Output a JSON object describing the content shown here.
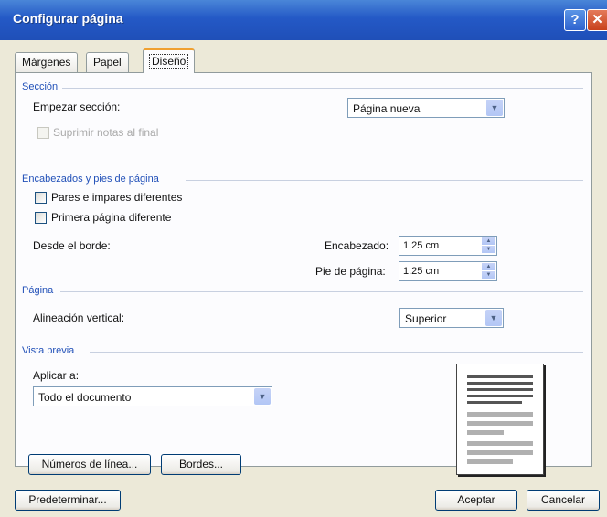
{
  "window": {
    "title": "Configurar página",
    "help_label": "?",
    "close_label": "✕"
  },
  "tabs": [
    {
      "label": "Márgenes",
      "active": false
    },
    {
      "label": "Papel",
      "active": false
    },
    {
      "label": "Diseño",
      "active": true
    }
  ],
  "seccion": {
    "heading": "Sección",
    "empezar_label": "Empezar sección:",
    "empezar_value": "Página nueva",
    "suprimir_label": "Suprimir notas al final",
    "suprimir_checked": false
  },
  "encabezados": {
    "heading": "Encabezados y pies de página",
    "pares_label": "Pares e impares diferentes",
    "pares_checked": false,
    "primera_label": "Primera página diferente",
    "primera_checked": false,
    "desde_label": "Desde el borde:",
    "encabezado_label": "Encabezado:",
    "encabezado_value": "1.25 cm",
    "pie_label": "Pie de página:",
    "pie_value": "1.25 cm"
  },
  "pagina": {
    "heading": "Página",
    "alineacion_label": "Alineación vertical:",
    "alineacion_value": "Superior"
  },
  "vista_previa": {
    "heading": "Vista previa",
    "aplicar_label": "Aplicar a:",
    "aplicar_value": "Todo el documento"
  },
  "buttons": {
    "numeros_linea": "Números de línea...",
    "bordes": "Bordes...",
    "predeterminar": "Predeterminar...",
    "aceptar": "Aceptar",
    "cancelar": "Cancelar"
  }
}
